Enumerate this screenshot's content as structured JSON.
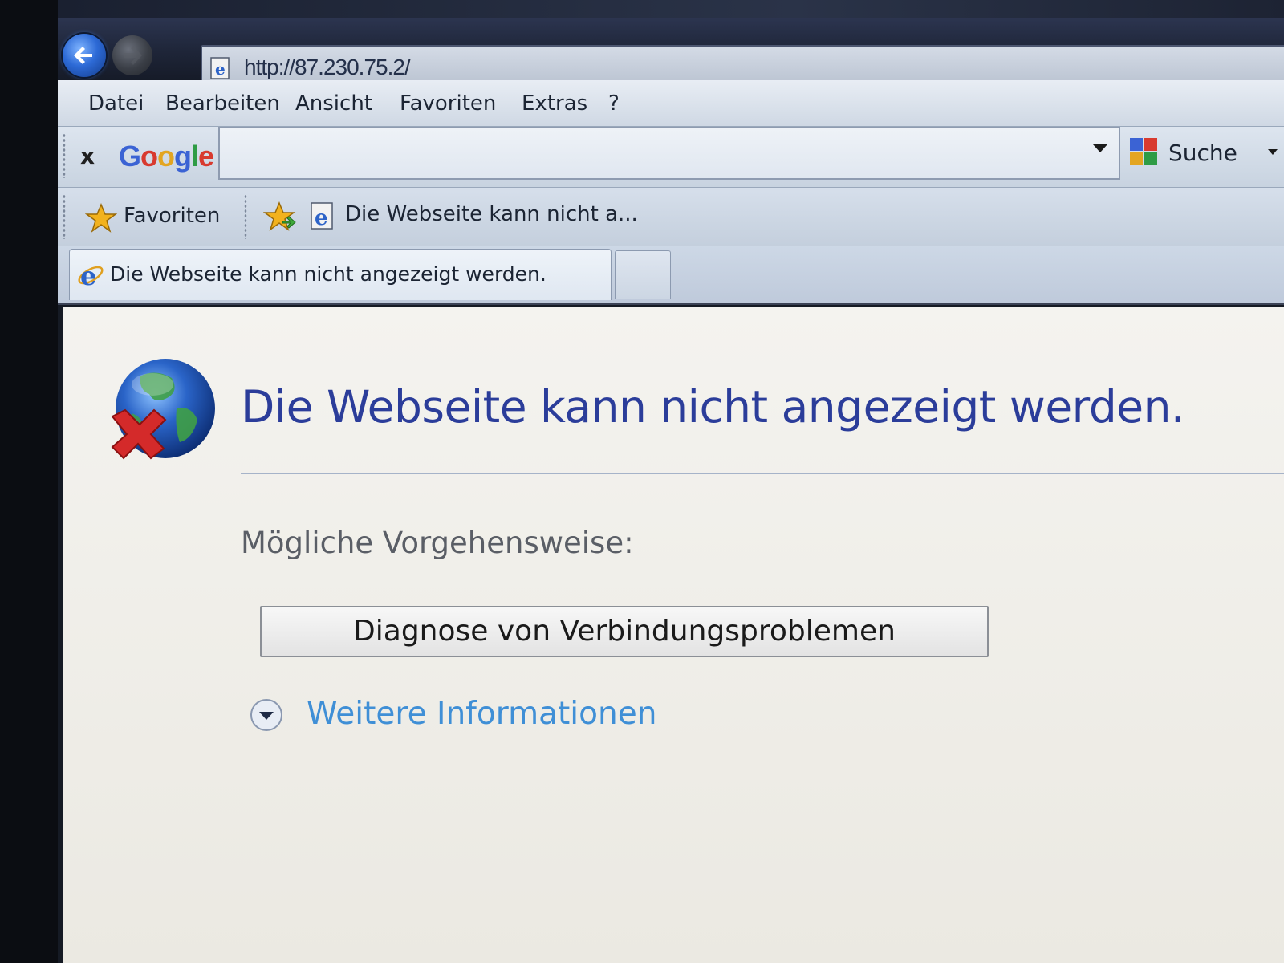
{
  "browser": {
    "address": "http://87.230.75.2/",
    "menu": [
      "Datei",
      "Bearbeiten",
      "Ansicht",
      "Favoriten",
      "Extras",
      "?"
    ],
    "google_toolbar": {
      "close_label": "x",
      "logo_letters": [
        "G",
        "o",
        "o",
        "g",
        "l",
        "e"
      ],
      "logo_colors": [
        "#3b63d4",
        "#d83a2f",
        "#e3a521",
        "#3b63d4",
        "#2f9c45",
        "#d83a2f"
      ],
      "search_value": "",
      "search_button_label": "Suche"
    },
    "favorites_bar": {
      "favorites_label": "Favoriten",
      "link_label": "Die Webseite kann nicht a..."
    },
    "tab": {
      "label": "Die Webseite kann nicht angezeigt werden."
    }
  },
  "page": {
    "title": "Die Webseite kann nicht angezeigt werden.",
    "actions_heading": "Mögliche Vorgehensweise:",
    "diagnose_button_label": "Diagnose von Verbindungsproblemen",
    "more_info_label": "Weitere Informationen"
  },
  "icons": {
    "back": "back-arrow-icon",
    "forward": "forward-arrow-icon",
    "page": "ie-page-icon",
    "favorites": "star-icon",
    "add_favorite": "add-favorite-icon",
    "tab": "ie-logo-icon",
    "error": "globe-error-icon",
    "expand": "chevron-down-circle-icon"
  },
  "colors": {
    "title": "#2b3d9a",
    "link": "#3f8fd6",
    "heading": "#5a5e66"
  }
}
